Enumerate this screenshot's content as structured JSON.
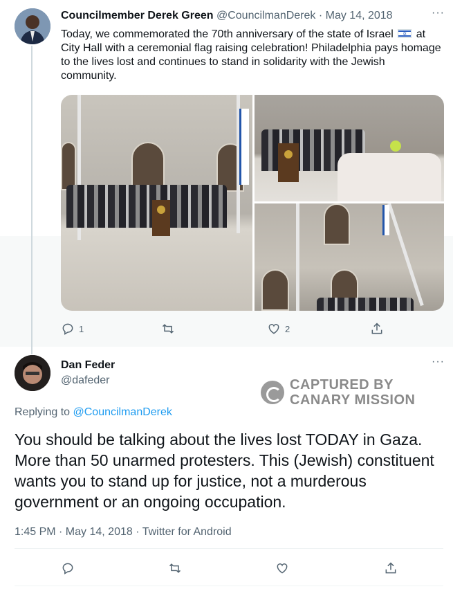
{
  "tweet1": {
    "author_name": "Councilmember Derek Green",
    "author_handle": "@CouncilmanDerek",
    "separator": "·",
    "date": "May 14, 2018",
    "more": "···",
    "text_before_flag": "Today, we commemorated the 70th anniversary of the state of Israel",
    "flag_icon": "israel-flag-icon",
    "text_after_flag": "at City Hall with a ceremonial flag raising celebration! Philadelphia pays homage to the lives lost and continues to stand in solidarity with the Jewish community.",
    "reply_count": "1",
    "retweet_count": "",
    "like_count": "2"
  },
  "tweet2": {
    "author_name": "Dan Feder",
    "author_handle": "@dafeder",
    "more": "···",
    "replying_prefix": "Replying to",
    "replying_to": "@CouncilmanDerek",
    "text": "You should be talking about the lives lost TODAY in Gaza. More than 50 unarmed protesters. This (Jewish) constituent wants you to stand up for justice, not a murderous government or an ongoing occupation.",
    "meta": "1:45 PM · May 14, 2018 · Twitter for Android"
  },
  "watermark": {
    "line1": "CAPTURED BY",
    "line2": "CANARY MISSION"
  },
  "colors": {
    "link": "#1d9bf0",
    "secondary_text": "#536471",
    "primary_text": "#0f1419"
  },
  "icons": [
    "reply-icon",
    "retweet-icon",
    "like-icon",
    "share-icon"
  ]
}
